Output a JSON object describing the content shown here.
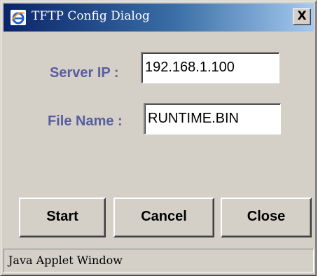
{
  "window": {
    "title": "TFTP Config Dialog",
    "close_label": "X",
    "icon": "ie-globe-icon"
  },
  "form": {
    "server_ip_label": "Server IP :",
    "server_ip_value": "192.168.1.100",
    "file_name_label": "File Name :",
    "file_name_value": "RUNTIME.BIN"
  },
  "buttons": {
    "start_label": "Start",
    "cancel_label": "Cancel",
    "close_label": "Close"
  },
  "status": {
    "text": "Java Applet Window"
  },
  "colors": {
    "dialog_bg": "#d4d0c8",
    "titlebar_start": "#0a246a",
    "titlebar_end": "#a6caf0",
    "label_color": "#585e9e"
  }
}
